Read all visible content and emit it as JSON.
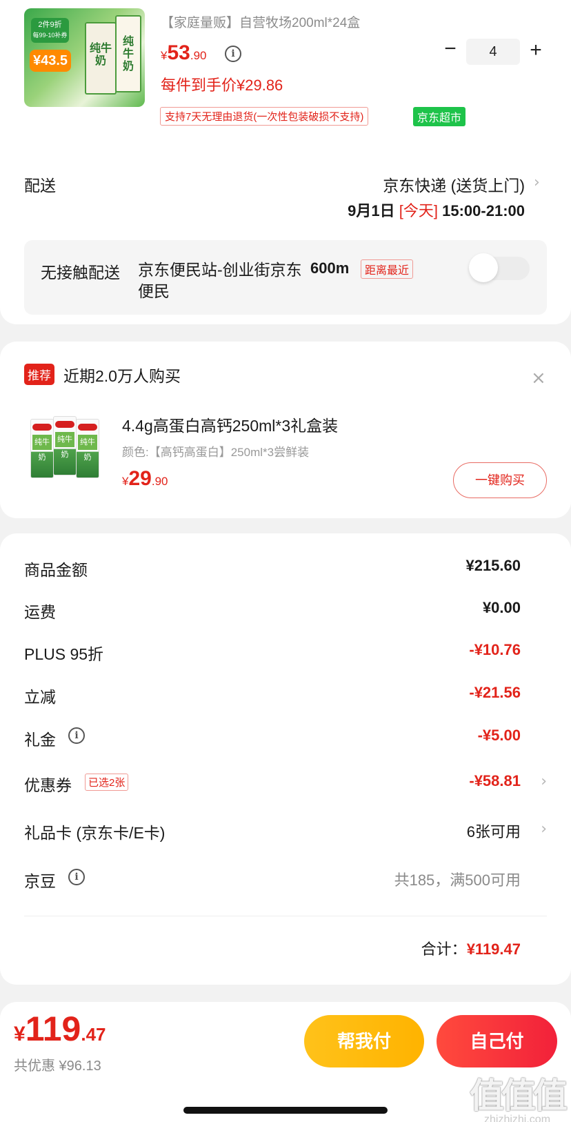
{
  "product": {
    "image": {
      "promo_line1": "2件9折",
      "promo_line2": "每99-10补券",
      "promo_price": "¥43.5",
      "carton_text": "纯牛奶"
    },
    "title": "【家庭量贩】自营牧场200ml*24盒",
    "price": {
      "currency": "¥",
      "integer": "53",
      "decimal": ".90"
    },
    "unit_price": "每件到手价¥29.86",
    "return_policy": "支持7天无理由退货(一次性包装破损不支持)",
    "store_tag": "京东超市",
    "quantity": {
      "minus": "−",
      "value": "4",
      "plus": "+"
    }
  },
  "shipping": {
    "label": "配送",
    "method": "京东快递 (送货上门)",
    "date": "9月1日",
    "today": "[今天]",
    "time": "15:00-21:00",
    "chevron": "›"
  },
  "pickup": {
    "label": "无接触配送",
    "station": "京东便民站-创业街京东便民",
    "distance": "600m",
    "tag": "距离最近",
    "enabled": false
  },
  "recommend": {
    "badge": "推荐",
    "title": "近期2.0万人购买",
    "close": "×",
    "carton_text": "纯牛奶",
    "name": "4.4g高蛋白高钙250ml*3礼盒装",
    "spec": "颜色:【高钙高蛋白】250ml*3尝鲜装",
    "price": {
      "currency": "¥",
      "integer": "29",
      "decimal": ".90"
    },
    "buy_label": "一键购买"
  },
  "summary": {
    "rows": [
      {
        "label": "商品金额",
        "value": "¥215.60"
      },
      {
        "label": "运费",
        "value": "¥0.00"
      },
      {
        "label": "PLUS 95折",
        "value": "-¥10.76"
      },
      {
        "label": "立减",
        "value": "-¥21.56"
      },
      {
        "label": "礼金",
        "value": "-¥5.00"
      },
      {
        "label": "优惠券",
        "tag": "已选2张",
        "value": "-¥58.81"
      },
      {
        "label": "礼品卡 (京东卡/E卡)",
        "value": "6张可用"
      },
      {
        "label": "京豆",
        "value": "共185，满500可用"
      }
    ],
    "total_label": "合计：",
    "total_value": "¥119.47"
  },
  "bottom_bar": {
    "currency": "¥",
    "total_integer": "119",
    "total_decimal": ".47",
    "saved": "共优惠 ¥96.13",
    "help_pay": "帮我付",
    "self_pay": "自己付",
    "watermark": "值值值",
    "watermark_url": "zhizhizhi.com"
  },
  "colors": {
    "accent_red": "#e2231a",
    "store_green": "#1ec34a",
    "help_button": "#ffb300",
    "pay_button": "#f2213a"
  }
}
